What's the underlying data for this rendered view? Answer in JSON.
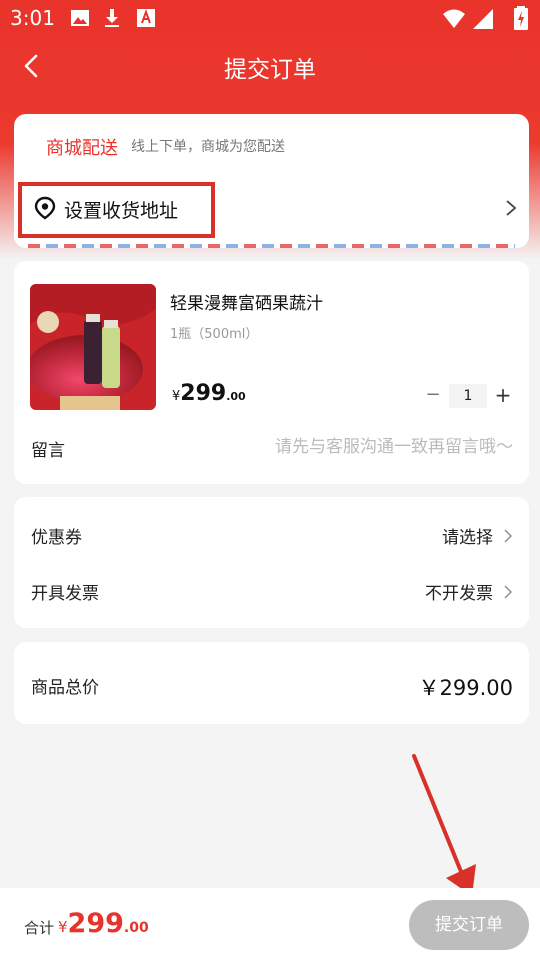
{
  "status_bar": {
    "time": "3:01",
    "left_icons": [
      "image-icon",
      "download-icon",
      "text-a-icon"
    ],
    "right_icons": [
      "wifi-icon",
      "signal-icon",
      "battery-charging-icon"
    ]
  },
  "nav": {
    "title": "提交订单",
    "back_icon": "chevron-left-icon"
  },
  "delivery": {
    "mode": "商城配送",
    "description": "线上下单，商城为您配送",
    "address_label": "设置收货地址",
    "address_icon": "location-pin-icon"
  },
  "product": {
    "name": "轻果漫舞富硒果蔬汁",
    "spec": "1瓶（500ml）",
    "price_currency": "¥",
    "price_int": "299",
    "price_dec": ".00",
    "quantity": "1",
    "minus": "−",
    "plus": "+"
  },
  "message": {
    "label": "留言",
    "placeholder": "请先与客服沟通一致再留言哦～"
  },
  "options": [
    {
      "label": "优惠券",
      "value": "请选择"
    },
    {
      "label": "开具发票",
      "value": "不开发票"
    }
  ],
  "total": {
    "label": "商品总价",
    "value": "￥299.00"
  },
  "footer": {
    "sum_label": "合计",
    "sum_currency": "¥",
    "sum_int": "299",
    "sum_dec": ".00",
    "submit_label": "提交订单"
  },
  "colors": {
    "brand_red": "#e8332b",
    "annotation_red": "#d9312a",
    "disabled_button": "#bdbdbd"
  }
}
